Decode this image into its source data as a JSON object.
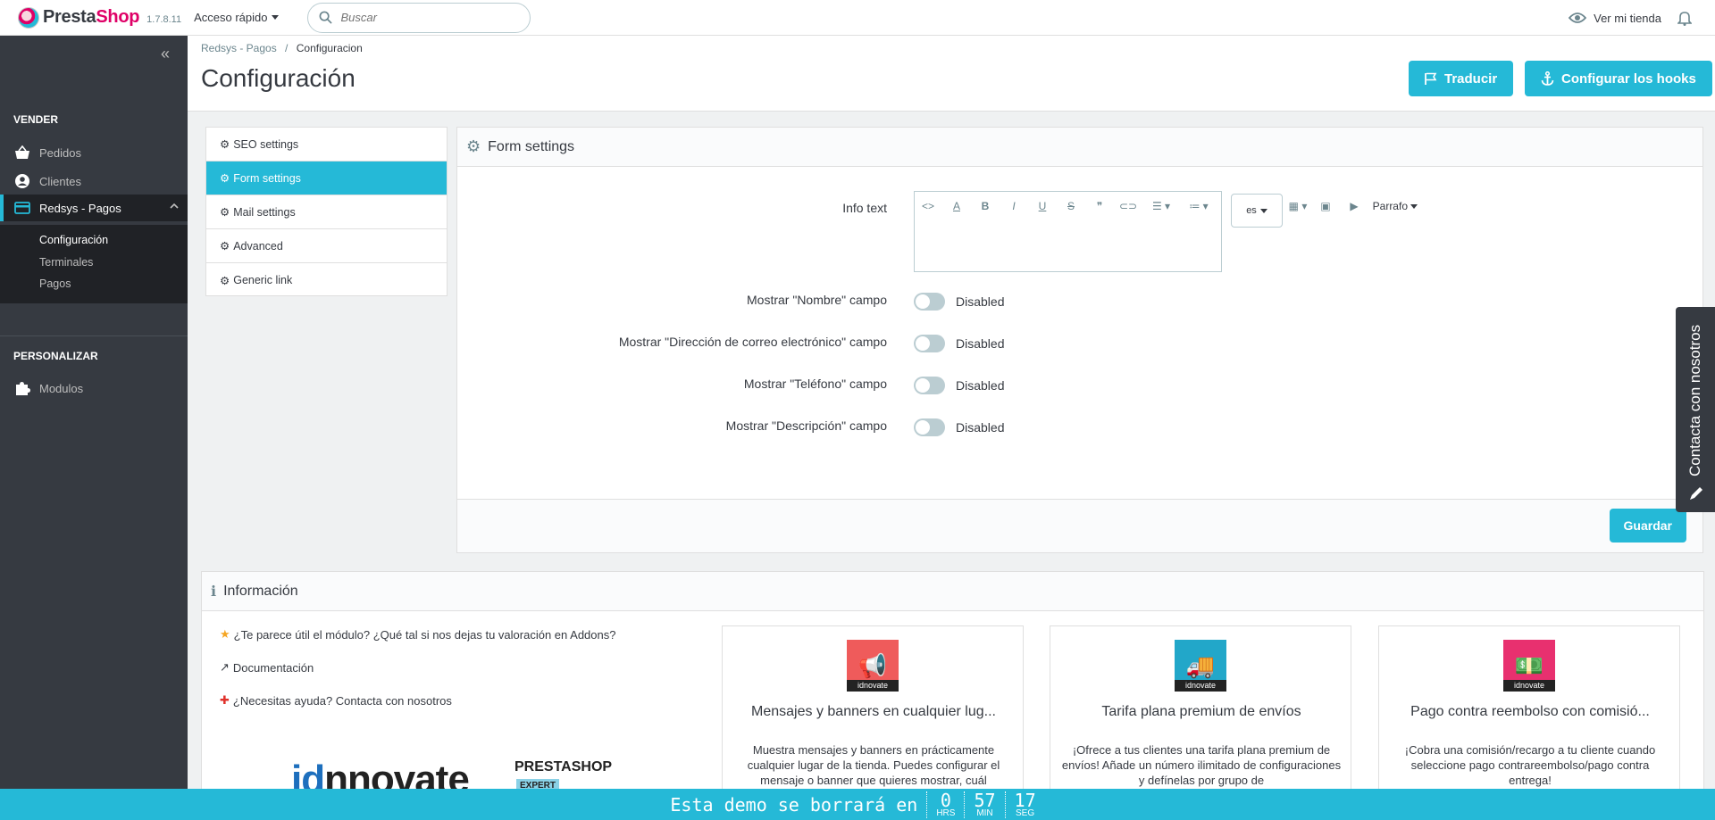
{
  "header": {
    "logo_text_a": "Presta",
    "logo_text_b": "Shop",
    "version": "1.7.8.11",
    "quick_access": "Acceso rápido",
    "search_placeholder": "Buscar",
    "view_shop": "Ver mi tienda"
  },
  "sidebar": {
    "section_sell": "VENDER",
    "items": [
      {
        "label": "Pedidos",
        "icon": "basket-icon"
      },
      {
        "label": "Clientes",
        "icon": "user-icon"
      },
      {
        "label": "Redsys - Pagos",
        "icon": "card-icon"
      }
    ],
    "submenu": [
      "Configuración",
      "Terminales",
      "Pagos"
    ],
    "section_customize": "PERSONALIZAR",
    "modules": "Modulos"
  },
  "page": {
    "breadcrumb_parent": "Redsys - Pagos",
    "breadcrumb_sep": "/",
    "breadcrumb_current": "Configuracion",
    "title": "Configuración",
    "translate_btn": "Traducir",
    "hooks_btn": "Configurar los hooks"
  },
  "tabs": [
    "SEO settings",
    "Form settings",
    "Mail settings",
    "Advanced",
    "Generic link"
  ],
  "form": {
    "heading": "Form settings",
    "info_text_label": "Info text",
    "lang": "es",
    "paragraph": "Parrafo",
    "fields": [
      {
        "label": "Mostrar \"Nombre\" campo",
        "state": "Disabled"
      },
      {
        "label": "Mostrar \"Dirección de correo electrónico\" campo",
        "state": "Disabled"
      },
      {
        "label": "Mostrar \"Teléfono\" campo",
        "state": "Disabled"
      },
      {
        "label": "Mostrar \"Descripción\" campo",
        "state": "Disabled"
      }
    ],
    "save": "Guardar"
  },
  "info": {
    "heading": "Información",
    "links": [
      "¿Te parece útil el módulo? ¿Qué tal si nos dejas tu valoración en Addons?",
      "Documentación",
      "¿Necesitas ayuda? Contacta con nosotros"
    ],
    "brand_a": "id",
    "brand_b": "nnovate",
    "ps_expert": "PRESTASHOP",
    "ps_badge": "EXPERT",
    "cards": [
      {
        "brand": "idnovate",
        "title": "Mensajes y banners en cualquier lug...",
        "desc": "Muestra mensajes y banners en prácticamente cualquier lugar de la tienda. Puedes configurar el mensaje o banner que quieres mostrar, cuál",
        "color": "#ef5b5b"
      },
      {
        "brand": "idnovate",
        "title": "Tarifa plana premium de envíos",
        "desc": "¡Ofrece a tus clientes una tarifa plana premium de envíos! Añade un número ilimitado de configuraciones y defínelas por grupo de",
        "color": "#22a7c9"
      },
      {
        "brand": "idnovate",
        "title": "Pago contra reembolso con comisió...",
        "desc": "¡Cobra una comisión/recargo a tu cliente cuando seleccione pago contrareembolso/pago contra entrega!",
        "color": "#e8306f"
      }
    ]
  },
  "contact_tab": "Contacta con nosotros",
  "demo": {
    "text": "Esta demo se borrará en",
    "hours": "0",
    "hours_lbl": "HRS",
    "minutes": "57",
    "minutes_lbl": "MIN",
    "seconds": "17",
    "seconds_lbl": "SEG"
  },
  "colors": {
    "accent": "#25b9d7",
    "sidebar": "#363a41",
    "brand_pink": "#df0067"
  }
}
